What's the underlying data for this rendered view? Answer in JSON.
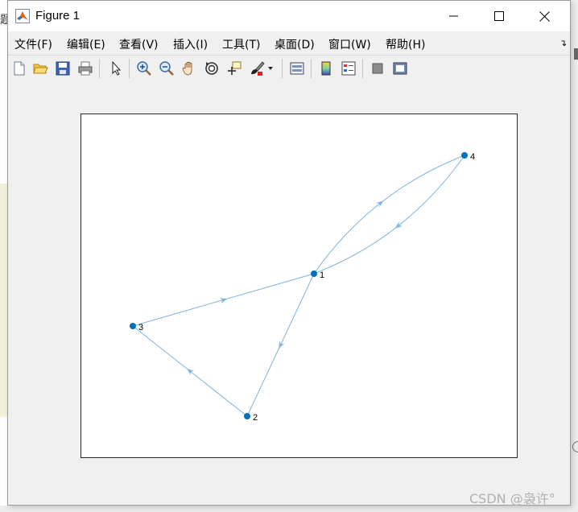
{
  "window": {
    "title": "Figure 1"
  },
  "menu": [
    {
      "label": "文件(F)"
    },
    {
      "label": "编辑(E)"
    },
    {
      "label": "查看(V)"
    },
    {
      "label": "插入(I)"
    },
    {
      "label": "工具(T)"
    },
    {
      "label": "桌面(D)"
    },
    {
      "label": "窗口(W)"
    },
    {
      "label": "帮助(H)"
    }
  ],
  "toolbar": {
    "icons": [
      "new-figure-icon",
      "open-file-icon",
      "save-icon",
      "print-icon",
      "select-pointer-icon",
      "zoom-in-icon",
      "zoom-out-icon",
      "pan-hand-icon",
      "rotate-3d-icon",
      "data-cursor-icon",
      "brush-icon",
      "link-plot-icon",
      "colorbar-icon",
      "legend-icon",
      "hide-plot-tools-icon",
      "show-plot-tools-icon"
    ]
  },
  "background": {
    "left_fragment_text": "题"
  },
  "chart_data": {
    "type": "graph",
    "directed": true,
    "node_color": "#0072bd",
    "edge_color": "#7db5df",
    "nodes": [
      {
        "id": "1",
        "label": "1"
      },
      {
        "id": "2",
        "label": "2"
      },
      {
        "id": "3",
        "label": "3"
      },
      {
        "id": "4",
        "label": "4"
      }
    ],
    "edges": [
      {
        "from": "1",
        "to": "2"
      },
      {
        "from": "1",
        "to": "4"
      },
      {
        "from": "4",
        "to": "1"
      },
      {
        "from": "2",
        "to": "3"
      },
      {
        "from": "3",
        "to": "1"
      }
    ]
  },
  "watermark": "CSDN @袅许°"
}
